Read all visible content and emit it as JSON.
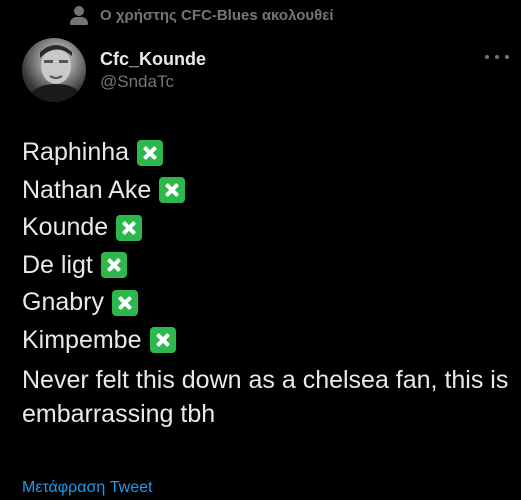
{
  "social_context": {
    "icon": "person-icon",
    "text": "Ο χρήστης CFC-Blues ακολουθεί"
  },
  "author": {
    "display_name": "Cfc_Kounde",
    "handle": "@SndaTc"
  },
  "tweet": {
    "players": [
      {
        "name": "Raphinha",
        "icon": "cross-mark-button-emoji"
      },
      {
        "name": "Nathan Ake",
        "icon": "cross-mark-button-emoji"
      },
      {
        "name": "Kounde",
        "icon": "cross-mark-button-emoji"
      },
      {
        "name": "De ligt",
        "icon": "cross-mark-button-emoji"
      },
      {
        "name": "Gnabry",
        "icon": "cross-mark-button-emoji"
      },
      {
        "name": "Kimpembe",
        "icon": "cross-mark-button-emoji"
      }
    ],
    "comment": "Never felt this down as a chelsea fan, this is embarrassing tbh"
  },
  "translate_label": "Μετάφραση Tweet",
  "colors": {
    "background": "#000000",
    "text": "#e7e9ea",
    "muted": "#71767b",
    "link": "#1d9bf0",
    "cross_emoji": "#2db84d"
  }
}
